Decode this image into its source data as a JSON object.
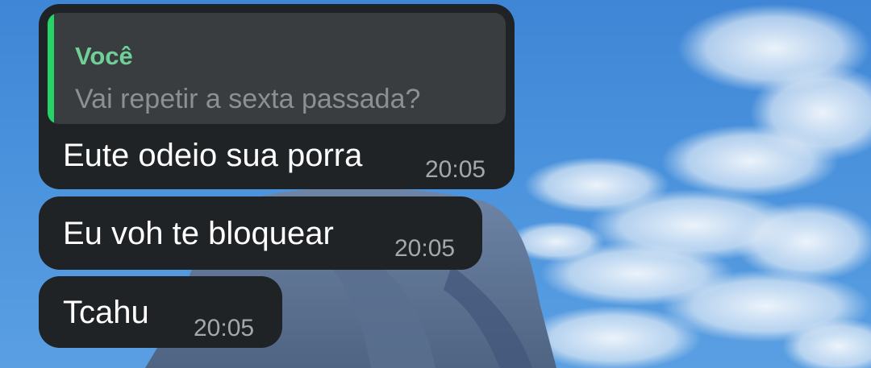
{
  "chat": {
    "messages": [
      {
        "quote": {
          "author": "Você",
          "text": "Vai repetir a sexta passada?"
        },
        "text": "Eute odeio sua porra",
        "time": "20:05"
      },
      {
        "text": "Eu voh te bloquear",
        "time": "20:05"
      },
      {
        "text": "Tcahu",
        "time": "20:05"
      }
    ]
  },
  "colors": {
    "bubble_background": "#1f2326",
    "quote_background": "#3a3d40",
    "quote_accent": "#25d366",
    "quote_author": "#6fcf97",
    "message_text": "#ffffff",
    "timestamp_text": "#a4a8ab",
    "sky": "#4a92dc"
  }
}
